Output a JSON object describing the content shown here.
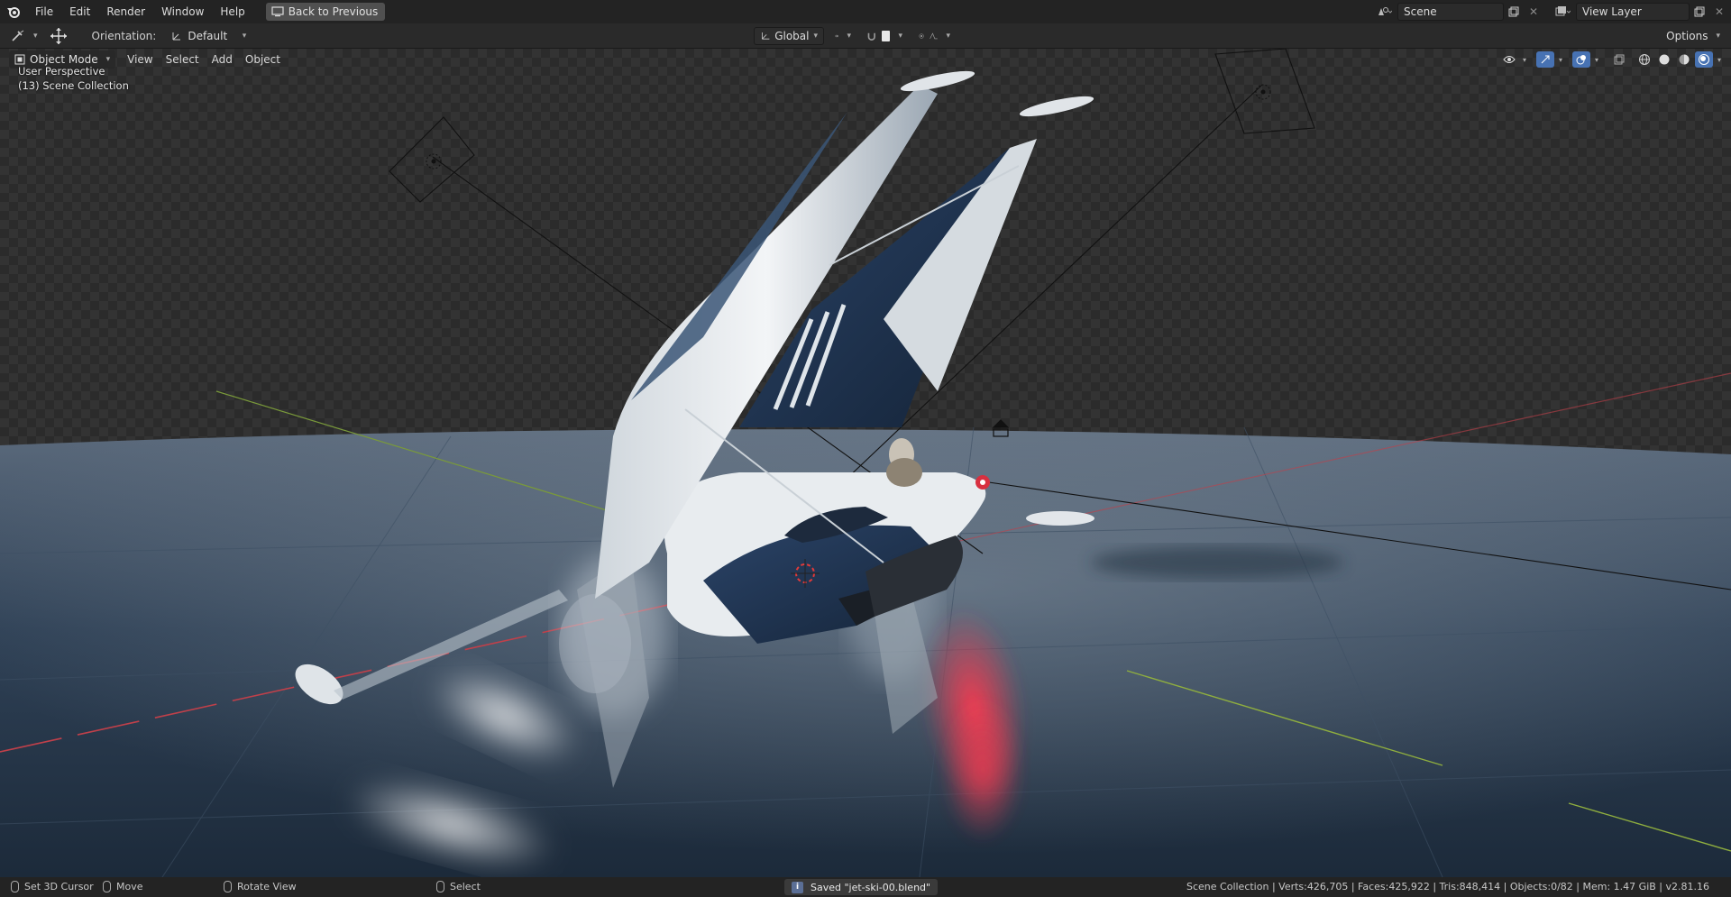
{
  "topbar": {
    "menus": [
      "File",
      "Edit",
      "Render",
      "Window",
      "Help"
    ],
    "back_button": "Back to Previous",
    "scene_name": "Scene",
    "view_layer": "View Layer"
  },
  "toolheader": {
    "orientation_label": "Orientation:",
    "orientation_value": "Default",
    "transform_space": "Global",
    "options_label": "Options"
  },
  "viewport": {
    "mode": "Object Mode",
    "menus": [
      "View",
      "Select",
      "Add",
      "Object"
    ],
    "perspective": "User Perspective",
    "collection": "(13) Scene Collection"
  },
  "statusbar": {
    "hint_1": "Set 3D Cursor",
    "hint_2": "Move",
    "hint_3": "Rotate View",
    "hint_4": "Select",
    "message": "Saved \"jet-ski-00.blend\"",
    "stats": "Scene Collection | Verts:426,705 | Faces:425,922 | Tris:848,414 | Objects:0/82 | Mem: 1.47 GiB | v2.81.16"
  },
  "colors": {
    "accent": "#4772b3",
    "axis_x": "#c0404a",
    "axis_y": "#7a9a3a",
    "hull_dark": "#1f3350",
    "hull_light": "#e6e9ec"
  }
}
